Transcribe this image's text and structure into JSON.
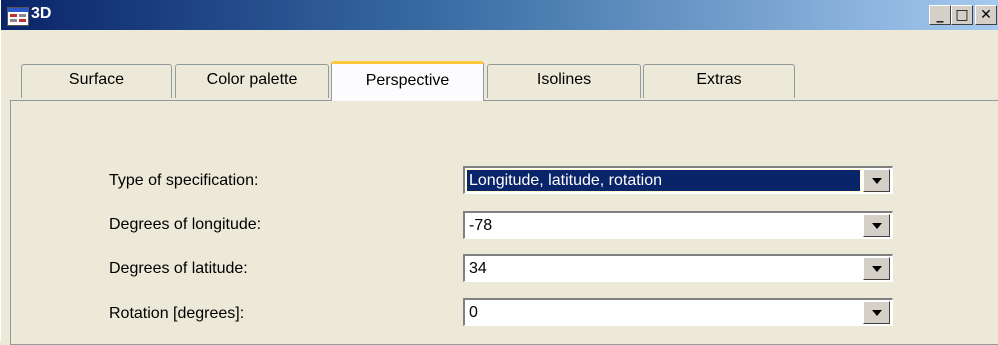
{
  "window": {
    "title": "3D",
    "controls": {
      "minimize": "_",
      "maximize": "□",
      "close": "✕"
    }
  },
  "tabs": [
    {
      "label": "Surface",
      "active": false
    },
    {
      "label": "Color palette",
      "active": false
    },
    {
      "label": "Perspective",
      "active": true
    },
    {
      "label": "Isolines",
      "active": false
    },
    {
      "label": "Extras",
      "active": false
    }
  ],
  "fields": [
    {
      "label": "Type of specification:",
      "value": "Longitude, latitude, rotation",
      "focused": true
    },
    {
      "label": "Degrees of longitude:",
      "value": "-78"
    },
    {
      "label": "Degrees of latitude:",
      "value": "34"
    },
    {
      "label": "Rotation [degrees]:",
      "value": "0"
    }
  ],
  "colors": {
    "titlebar_start": "#0a246a",
    "titlebar_end": "#a6caf0",
    "active_tab_highlight": "#ffc83c",
    "selection": "#0a246a"
  },
  "icons": {
    "app": "table-grid-icon",
    "dropdown": "chevron-down-icon"
  }
}
